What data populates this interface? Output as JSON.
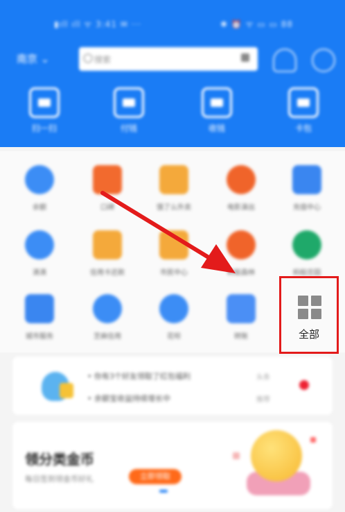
{
  "colors": {
    "brand_blue": "#1a7cf5",
    "highlight_red": "#e31b1b",
    "arrow_red": "#e31b1b"
  },
  "status_bar": {
    "left_text": "▮ıll ıll ᯤ 3:41 ✉ ···",
    "right_text": "✱ ⏰ ᯤ ▭ ▭ 88"
  },
  "header": {
    "city": "南京 ⌄",
    "search": {
      "placeholder": "搜索"
    },
    "actions": [
      {
        "label": "扫一扫",
        "icon": "scan-icon"
      },
      {
        "label": "付钱",
        "icon": "pay-icon"
      },
      {
        "label": "收钱",
        "icon": "receive-icon"
      },
      {
        "label": "卡包",
        "icon": "wallet-icon"
      }
    ]
  },
  "grid": {
    "items": [
      {
        "label": "余额",
        "color": "#3c8df5",
        "icon": "clock-icon"
      },
      {
        "label": "口碑",
        "color": "#f26a2e",
        "icon": "koubei-icon"
      },
      {
        "label": "饿了么外卖",
        "color": "#f4a93b",
        "icon": "takeout-icon"
      },
      {
        "label": "电影演出",
        "color": "#f0642a",
        "icon": "movie-icon"
      },
      {
        "label": "充值中心",
        "color": "#3a86f0",
        "icon": "phone-icon"
      },
      {
        "label": "滴滴",
        "color": "#3c8df5",
        "icon": "ride-icon"
      },
      {
        "label": "信用卡还款",
        "color": "#f4a93b",
        "icon": "card-icon"
      },
      {
        "label": "市民中心",
        "color": "#f4a93b",
        "icon": "citizen-icon"
      },
      {
        "label": "蚂蚁森林",
        "color": "#f0642a",
        "icon": "forest-icon"
      },
      {
        "label": "蚂蚁庄园",
        "color": "#1fa96a",
        "icon": "farm-icon"
      },
      {
        "label": "城市服务",
        "color": "#3a86f0",
        "icon": "city-service-icon"
      },
      {
        "label": "芝麻信用",
        "color": "#3c8df5",
        "icon": "sesame-icon"
      },
      {
        "label": "花呗",
        "color": "#3c8df5",
        "icon": "huabei-icon"
      },
      {
        "label": "转账",
        "color": "#4b8ff5",
        "icon": "transfer-icon"
      }
    ],
    "all_button": {
      "label": "全部",
      "icon": "grid-icon"
    }
  },
  "news": {
    "lines": [
      {
        "text": "• 你有3个好友领取了红包福利",
        "tag": "头条"
      },
      {
        "text": "• 余额宝收益持续增长中",
        "tag": "推荐"
      }
    ]
  },
  "promo": {
    "title": "领分类金币",
    "subtitle": "每日签到领金币好礼",
    "button": "立即领取"
  }
}
